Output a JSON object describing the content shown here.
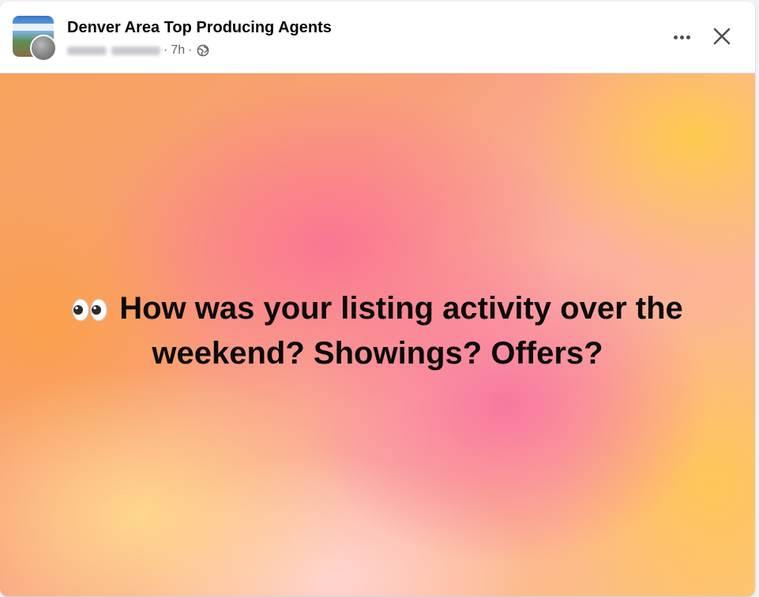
{
  "header": {
    "group_name": "Denver Area Top Producing Agents",
    "time": "7h",
    "separator": "·",
    "audience_icon": "globe-icon",
    "more_icon": "more-horizontal-icon",
    "close_icon": "close-icon"
  },
  "post": {
    "icon": "eyes-emoji-icon",
    "text": "How was your listing activity over the weekend? Showings? Offers?"
  },
  "colors": {
    "text_primary": "#050505",
    "text_secondary": "#65676b",
    "header_bg": "#ffffff"
  }
}
